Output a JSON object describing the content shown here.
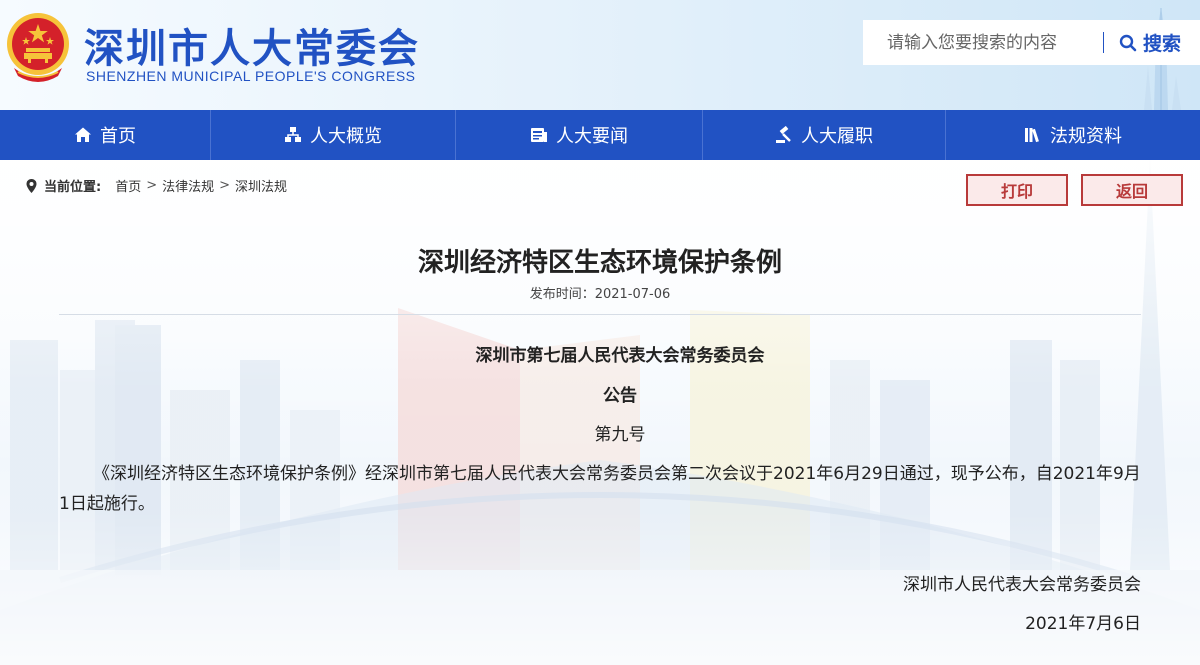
{
  "header": {
    "title": "深圳市人大常委会",
    "subtitle": "SHENZHEN MUNICIPAL PEOPLE'S CONGRESS",
    "search_placeholder": "请输入您要搜索的内容",
    "search_label": "搜索"
  },
  "nav": {
    "items": [
      {
        "label": "首页",
        "icon": "home-icon"
      },
      {
        "label": "人大概览",
        "icon": "org-chart-icon"
      },
      {
        "label": "人大要闻",
        "icon": "news-icon"
      },
      {
        "label": "人大履职",
        "icon": "gavel-icon"
      },
      {
        "label": "法规资料",
        "icon": "books-icon"
      }
    ]
  },
  "breadcrumb": {
    "label": "当前位置:",
    "items": [
      "首页",
      "法律法规",
      "深圳法规"
    ],
    "separator": ">"
  },
  "actions": {
    "print_label": "打印",
    "back_label": "返回"
  },
  "article": {
    "title": "深圳经济特区生态环境保护条例",
    "publish_time": "发布时间：2021-07-06",
    "issuer": "深圳市第七届人民代表大会常务委员会",
    "notice_label": "公告",
    "notice_number": "第九号",
    "body": "《深圳经济特区生态环境保护条例》经深圳市第七届人民代表大会常务委员会第二次会议于2021年6月29日通过，现予公布，自2021年9月1日起施行。",
    "signature_org": "深圳市人民代表大会常务委员会",
    "signature_date": "2021年7月6日"
  },
  "colors": {
    "brand_blue": "#2152c3",
    "button_red": "#b83a3a",
    "emblem_red": "#d4212a",
    "emblem_gold": "#f6c33a"
  }
}
